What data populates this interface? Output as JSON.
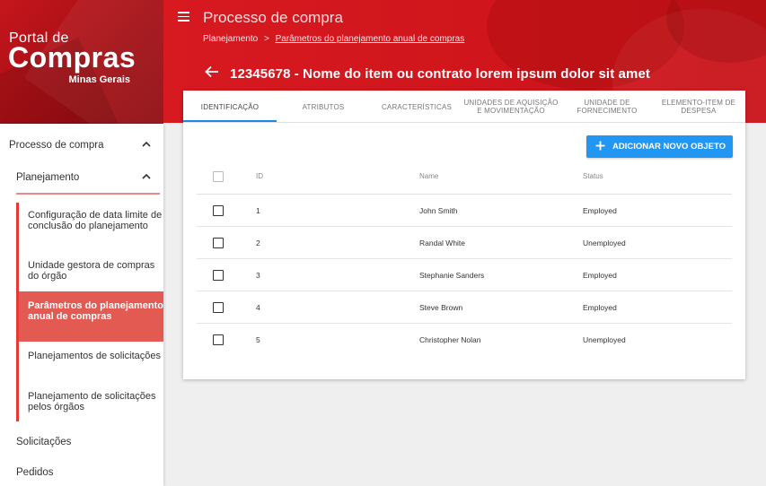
{
  "logo": {
    "line1": "Portal de",
    "line2": "Compras",
    "line3": "Minas Gerais"
  },
  "sidebar": {
    "processo": "Processo de compra",
    "planejamento": "Planejamento",
    "sub_items": [
      "Configuração de data limite de conclusão do planejamento",
      "Unidade gestora de compras do órgão",
      "Parâmetros do planejamento anual de compras",
      "Planejamentos de solicitações",
      "Planejamento de solicitações pelos órgãos"
    ],
    "solicitacoes": "Solicitações",
    "pedidos": "Pedidos"
  },
  "header": {
    "title": "Processo de compra",
    "breadcrumb_root": "Planejamento",
    "breadcrumb_sep": ">",
    "breadcrumb_current": "Parâmetros do planejamento anual de compras",
    "item_title": "12345678 - Nome do item ou contrato lorem ipsum dolor sit amet"
  },
  "tabs": [
    "IDENTIFICAÇÃO",
    "ATRIBUTOS",
    "CARACTERÍSTICAS",
    "UNIDADES DE AQUISIÇÃO E MOVIMENTAÇÃO",
    "UNIDADE DE FORNECIMENTO",
    "ELEMENTO-ITEM DE DESPESA"
  ],
  "add_button": "ADICIONAR NOVO OBJETO",
  "table": {
    "columns": {
      "id": "ID",
      "name": "Name",
      "status": "Status"
    },
    "rows": [
      {
        "id": "1",
        "name": "John Smith",
        "status": "Employed"
      },
      {
        "id": "2",
        "name": "Randal White",
        "status": "Unemployed"
      },
      {
        "id": "3",
        "name": "Stephanie Sanders",
        "status": "Employed"
      },
      {
        "id": "4",
        "name": "Steve Brown",
        "status": "Employed"
      },
      {
        "id": "5",
        "name": "Christopher Nolan",
        "status": "Unemployed"
      }
    ]
  },
  "colors": {
    "brand_red": "#d71920",
    "accent_blue": "#2196f3",
    "active_item": "#e35a52"
  }
}
